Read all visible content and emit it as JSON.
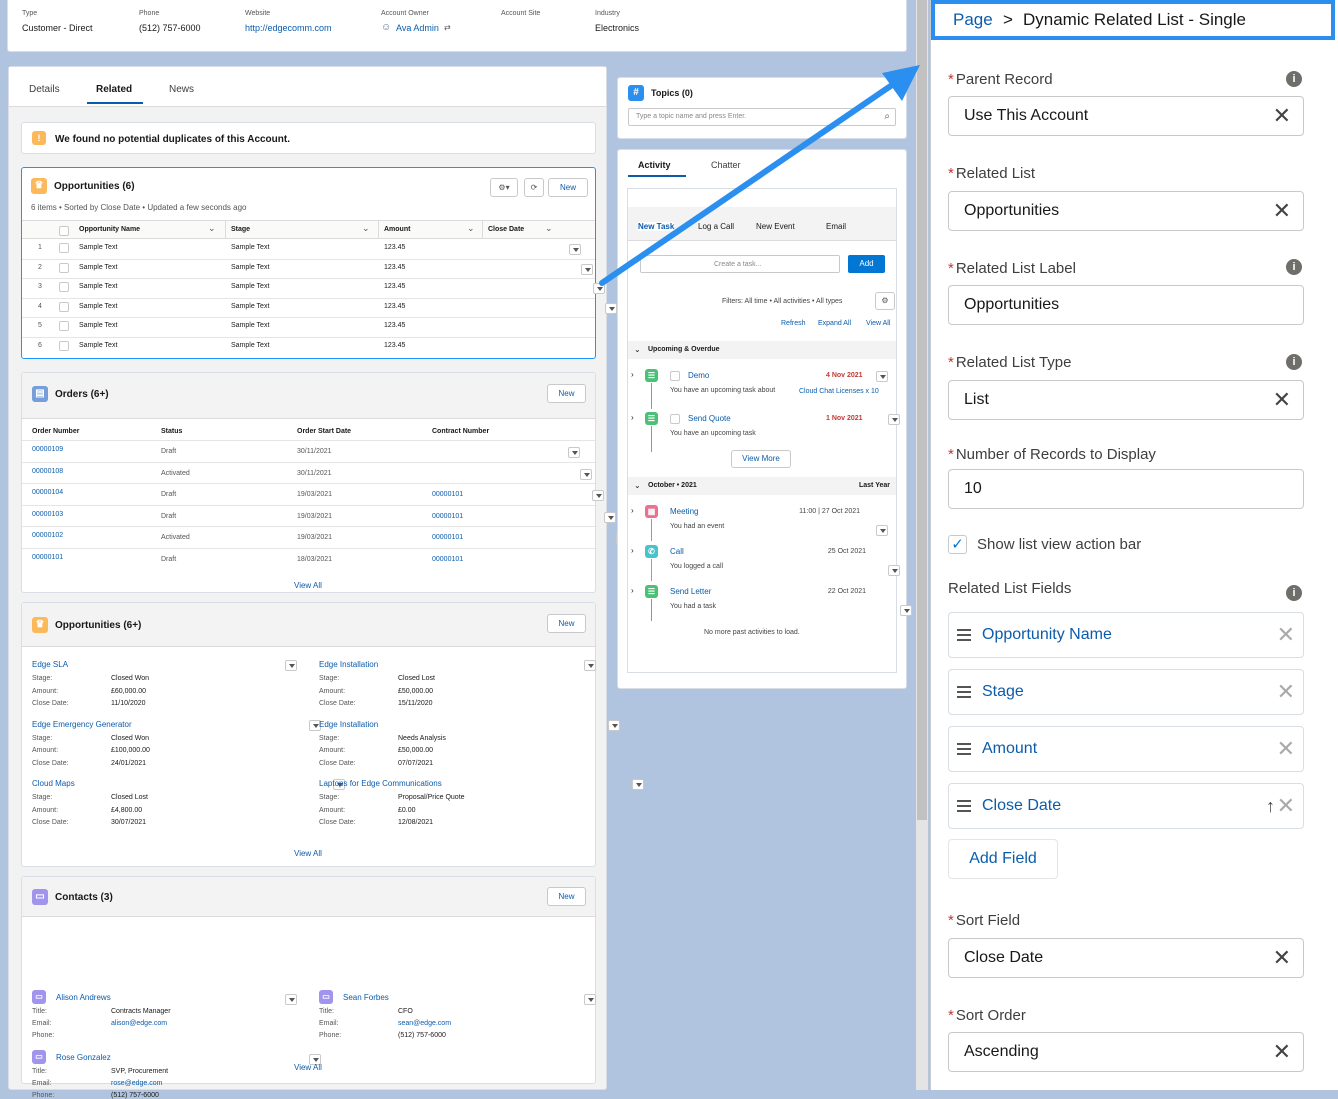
{
  "header": {
    "fields": [
      {
        "label": "Type",
        "value": "Customer - Direct"
      },
      {
        "label": "Phone",
        "value": "(512) 757-6000"
      },
      {
        "label": "Website",
        "value": "http://edgecomm.com"
      },
      {
        "label": "Account Owner",
        "value": "Ava Admin"
      },
      {
        "label": "Account Site",
        "value": ""
      },
      {
        "label": "Industry",
        "value": "Electronics"
      }
    ]
  },
  "tabs": [
    "Details",
    "Related",
    "News"
  ],
  "duplicates": "We found no potential duplicates of this Account.",
  "opps_table": {
    "title": "Opportunities (6)",
    "meta": "6 items • Sorted by Close Date • Updated a few seconds ago",
    "new": "New",
    "columns": [
      "Opportunity Name",
      "Stage",
      "Amount",
      "Close Date"
    ],
    "rows": [
      {
        "n": "1",
        "name": "Sample Text",
        "stage": "Sample Text",
        "amount": "123.45"
      },
      {
        "n": "2",
        "name": "Sample Text",
        "stage": "Sample Text",
        "amount": "123.45"
      },
      {
        "n": "3",
        "name": "Sample Text",
        "stage": "Sample Text",
        "amount": "123.45"
      },
      {
        "n": "4",
        "name": "Sample Text",
        "stage": "Sample Text",
        "amount": "123.45"
      },
      {
        "n": "5",
        "name": "Sample Text",
        "stage": "Sample Text",
        "amount": "123.45"
      },
      {
        "n": "6",
        "name": "Sample Text",
        "stage": "Sample Text",
        "amount": "123.45"
      }
    ]
  },
  "orders": {
    "title": "Orders (6+)",
    "new": "New",
    "columns": [
      "Order Number",
      "Status",
      "Order Start Date",
      "Contract Number"
    ],
    "rows": [
      {
        "num": "00000109",
        "status": "Draft",
        "date": "30/11/2021",
        "contract": ""
      },
      {
        "num": "00000108",
        "status": "Activated",
        "date": "30/11/2021",
        "contract": ""
      },
      {
        "num": "00000104",
        "status": "Draft",
        "date": "19/03/2021",
        "contract": "00000101"
      },
      {
        "num": "00000103",
        "status": "Draft",
        "date": "19/03/2021",
        "contract": "00000101"
      },
      {
        "num": "00000102",
        "status": "Activated",
        "date": "19/03/2021",
        "contract": "00000101"
      },
      {
        "num": "00000101",
        "status": "Draft",
        "date": "18/03/2021",
        "contract": "00000101"
      }
    ],
    "view_all": "View All"
  },
  "opps_tiles": {
    "title": "Opportunities (6+)",
    "new": "New",
    "labels": {
      "stage": "Stage:",
      "amount": "Amount:",
      "close": "Close Date:"
    },
    "items": [
      {
        "name": "Edge SLA",
        "stage": "Closed Won",
        "amount": "£60,000.00",
        "close": "11/10/2020"
      },
      {
        "name": "Edge Installation",
        "stage": "Closed Lost",
        "amount": "£50,000.00",
        "close": "15/11/2020"
      },
      {
        "name": "Edge Emergency Generator",
        "stage": "Closed Won",
        "amount": "£100,000.00",
        "close": "24/01/2021"
      },
      {
        "name": "Edge Installation",
        "stage": "Needs Analysis",
        "amount": "£50,000.00",
        "close": "07/07/2021"
      },
      {
        "name": "Cloud Maps",
        "stage": "Closed Lost",
        "amount": "£4,800.00",
        "close": "30/07/2021"
      },
      {
        "name": "Laptops for Edge Communications",
        "stage": "Proposal/Price Quote",
        "amount": "£0.00",
        "close": "12/08/2021"
      }
    ],
    "view_all": "View All"
  },
  "contacts": {
    "title": "Contacts (3)",
    "new": "New",
    "labels": {
      "title": "Title:",
      "email": "Email:",
      "phone": "Phone:"
    },
    "items": [
      {
        "name": "Alison Andrews",
        "title": "Contracts Manager",
        "email": "alison@edge.com",
        "phone": ""
      },
      {
        "name": "Sean Forbes",
        "title": "CFO",
        "email": "sean@edge.com",
        "phone": "(512) 757-6000"
      },
      {
        "name": "Rose Gonzalez",
        "title": "SVP, Procurement",
        "email": "rose@edge.com",
        "phone": "(512) 757-6000"
      }
    ],
    "view_all": "View All"
  },
  "topics": {
    "title": "Topics (0)",
    "placeholder": "Type a topic name and press Enter."
  },
  "activity": {
    "tabs": [
      "Activity",
      "Chatter"
    ],
    "subtabs": [
      "New Task",
      "Log a Call",
      "New Event",
      "Email"
    ],
    "create_placeholder": "Create a task...",
    "add": "Add",
    "filters": "Filters: All time • All activities • All types",
    "links": [
      "Refresh",
      "Expand All",
      "View All"
    ],
    "upcoming": "Upcoming & Overdue",
    "items_up": [
      {
        "title": "Demo",
        "date": "4 Nov 2021",
        "desc": "You have an upcoming task about",
        "extra": "Cloud Chat Licenses x 10"
      },
      {
        "title": "Send Quote",
        "date": "1 Nov 2021",
        "desc": "You have an upcoming task",
        "extra": ""
      }
    ],
    "view_more": "View More",
    "month": "October • 2021",
    "last_year": "Last Year",
    "items_past": [
      {
        "title": "Meeting",
        "date": "11:00 | 27 Oct 2021",
        "desc": "You had an event"
      },
      {
        "title": "Call",
        "date": "25 Oct 2021",
        "desc": "You logged a call"
      },
      {
        "title": "Send Letter",
        "date": "22 Oct 2021",
        "desc": "You had a task"
      }
    ],
    "no_more": "No more past activities to load."
  },
  "panel": {
    "breadcrumb_page": "Page",
    "breadcrumb_sep": ">",
    "breadcrumb_title": "Dynamic Related List - Single",
    "parent_record_label": "Parent Record",
    "parent_record_value": "Use This Account",
    "related_list_label": "Related List",
    "related_list_value": "Opportunities",
    "rl_label_label": "Related List Label",
    "rl_label_value": "Opportunities",
    "rl_type_label": "Related List Type",
    "rl_type_value": "List",
    "num_records_label": "Number of Records to Display",
    "num_records_value": "10",
    "show_action_bar": "Show list view action bar",
    "fields_title": "Related List Fields",
    "fields": [
      "Opportunity Name",
      "Stage",
      "Amount",
      "Close Date"
    ],
    "add_field": "Add Field",
    "sort_field_label": "Sort Field",
    "sort_field_value": "Close Date",
    "sort_order_label": "Sort Order",
    "sort_order_value": "Ascending"
  },
  "colors": {
    "accent": "#2b8fef",
    "link": "#0b5cab",
    "required": "#c23934",
    "opp_icon": "#fcb95b",
    "order_icon": "#769ed9",
    "contact_icon": "#a094ed",
    "task_icon": "#4bc076",
    "event_icon": "#eb7092",
    "call_icon": "#48c3cc"
  }
}
